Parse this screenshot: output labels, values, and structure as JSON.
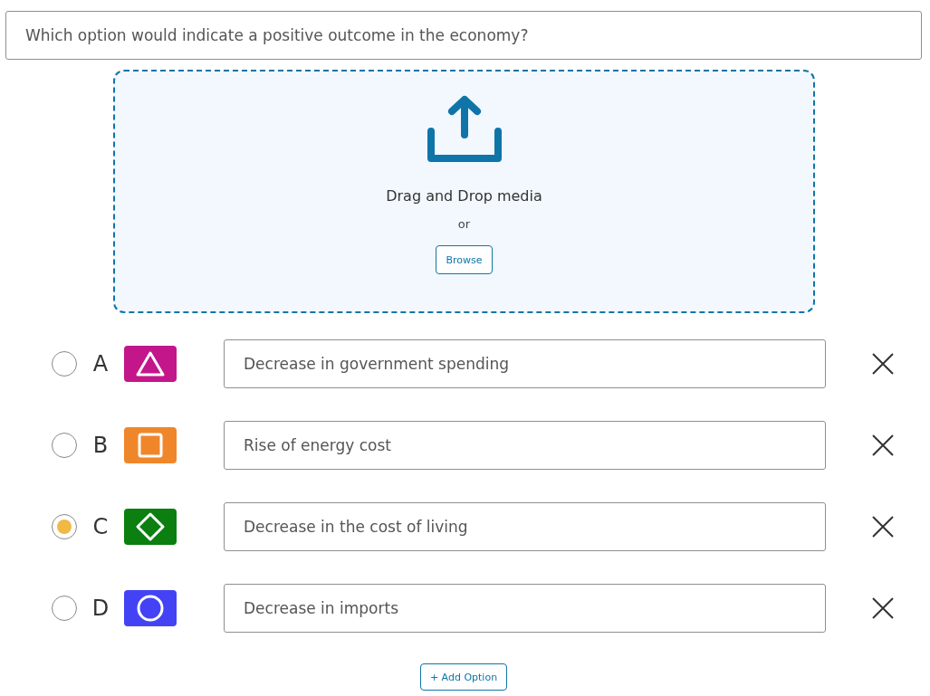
{
  "question": {
    "value": "Which option would indicate a positive outcome in the economy?"
  },
  "upload": {
    "prompt": "Drag and Drop media",
    "separator": "or",
    "button": "Browse"
  },
  "options": [
    {
      "letter": "A",
      "kind": "triangle",
      "color": "#c3168a",
      "value": "Decrease in government spending",
      "selected": false
    },
    {
      "letter": "B",
      "kind": "square",
      "color": "#f0862a",
      "value": "Rise of energy cost",
      "selected": false
    },
    {
      "letter": "C",
      "kind": "diamond",
      "color": "#0b7f10",
      "value": "Decrease in the cost of living",
      "selected": true
    },
    {
      "letter": "D",
      "kind": "circle",
      "color": "#4343f5",
      "value": "Decrease in imports",
      "selected": false
    }
  ],
  "add_button": "+ Add Option"
}
